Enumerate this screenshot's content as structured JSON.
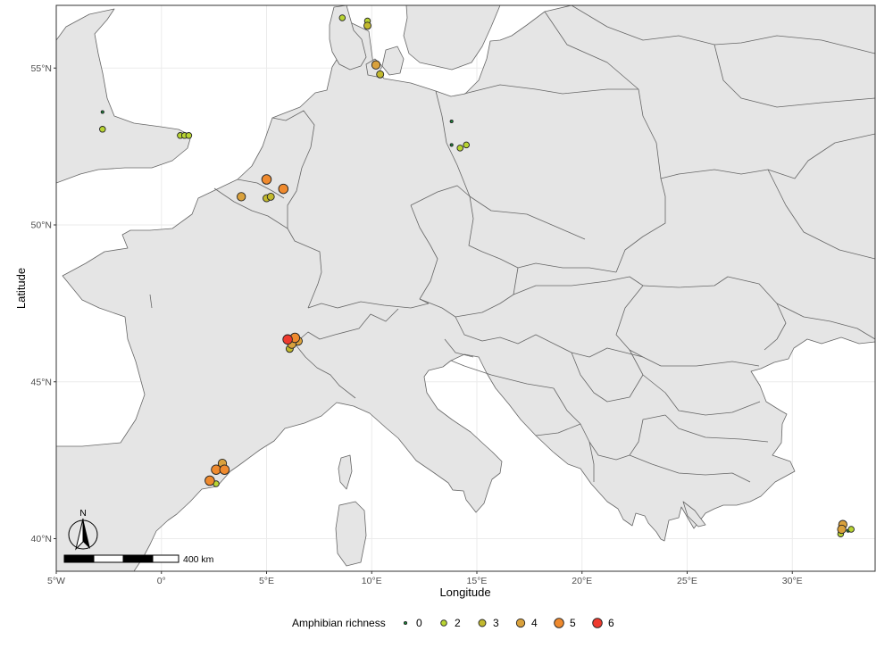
{
  "chart_data": {
    "type": "scatter",
    "xlabel": "Longitude",
    "ylabel": "Latitude",
    "xlim": [
      -5,
      34
    ],
    "ylim": [
      39,
      57.2
    ],
    "x_ticks": [
      {
        "value": -5,
        "label": "5°W"
      },
      {
        "value": 0,
        "label": "0°"
      },
      {
        "value": 5,
        "label": "5°E"
      },
      {
        "value": 10,
        "label": "10°E"
      },
      {
        "value": 15,
        "label": "15°E"
      },
      {
        "value": 20,
        "label": "20°E"
      },
      {
        "value": 25,
        "label": "25°E"
      },
      {
        "value": 30,
        "label": "30°E"
      }
    ],
    "y_ticks": [
      {
        "value": 40,
        "label": "40°N"
      },
      {
        "value": 45,
        "label": "45°N"
      },
      {
        "value": 50,
        "label": "50°N"
      },
      {
        "value": 55,
        "label": "55°N"
      }
    ],
    "legend": {
      "title": "Amphibian richness",
      "position": "bottom",
      "entries": [
        {
          "label": "0",
          "value": 0
        },
        {
          "label": "2",
          "value": 2
        },
        {
          "label": "3",
          "value": 3
        },
        {
          "label": "4",
          "value": 4
        },
        {
          "label": "5",
          "value": 5
        },
        {
          "label": "6",
          "value": 6
        }
      ]
    },
    "scalebar_label": "400 km",
    "north_label": "N",
    "colors": {
      "0": "#1a8a3a",
      "2": "#b8d432",
      "3": "#c2b92e",
      "4": "#d9a13c",
      "5": "#ef8a2e",
      "6": "#ee3a2e"
    },
    "points": [
      {
        "lon": -2.8,
        "lat": 53.6,
        "richness": 0
      },
      {
        "lon": -2.8,
        "lat": 53.05,
        "richness": 2
      },
      {
        "lon": 0.9,
        "lat": 52.85,
        "richness": 2
      },
      {
        "lon": 1.1,
        "lat": 52.85,
        "richness": 2
      },
      {
        "lon": 1.3,
        "lat": 52.85,
        "richness": 2
      },
      {
        "lon": 8.6,
        "lat": 56.6,
        "richness": 2
      },
      {
        "lon": 9.8,
        "lat": 56.5,
        "richness": 2
      },
      {
        "lon": 9.8,
        "lat": 56.35,
        "richness": 3
      },
      {
        "lon": 10.2,
        "lat": 55.1,
        "richness": 4
      },
      {
        "lon": 10.4,
        "lat": 54.8,
        "richness": 3
      },
      {
        "lon": 13.8,
        "lat": 53.3,
        "richness": 0
      },
      {
        "lon": 13.8,
        "lat": 52.55,
        "richness": 0
      },
      {
        "lon": 14.2,
        "lat": 52.45,
        "richness": 2
      },
      {
        "lon": 14.5,
        "lat": 52.55,
        "richness": 2
      },
      {
        "lon": 5.0,
        "lat": 51.45,
        "richness": 5
      },
      {
        "lon": 5.8,
        "lat": 51.15,
        "richness": 5
      },
      {
        "lon": 3.8,
        "lat": 50.9,
        "richness": 4
      },
      {
        "lon": 5.0,
        "lat": 50.85,
        "richness": 3
      },
      {
        "lon": 5.2,
        "lat": 50.9,
        "richness": 3
      },
      {
        "lon": 6.0,
        "lat": 46.35,
        "richness": 6
      },
      {
        "lon": 6.35,
        "lat": 46.4,
        "richness": 5
      },
      {
        "lon": 6.5,
        "lat": 46.3,
        "richness": 4
      },
      {
        "lon": 6.2,
        "lat": 46.2,
        "richness": 4
      },
      {
        "lon": 6.1,
        "lat": 46.05,
        "richness": 3
      },
      {
        "lon": 2.9,
        "lat": 42.4,
        "richness": 4
      },
      {
        "lon": 2.6,
        "lat": 42.2,
        "richness": 5
      },
      {
        "lon": 3.0,
        "lat": 42.2,
        "richness": 5
      },
      {
        "lon": 2.3,
        "lat": 41.85,
        "richness": 5
      },
      {
        "lon": 2.6,
        "lat": 41.75,
        "richness": 2
      },
      {
        "lon": 32.4,
        "lat": 40.45,
        "richness": 4
      },
      {
        "lon": 32.35,
        "lat": 40.3,
        "richness": 4
      },
      {
        "lon": 32.3,
        "lat": 40.15,
        "richness": 2
      },
      {
        "lon": 32.8,
        "lat": 40.3,
        "richness": 2
      },
      {
        "lon": 32.65,
        "lat": 40.25,
        "richness": 0
      }
    ]
  }
}
